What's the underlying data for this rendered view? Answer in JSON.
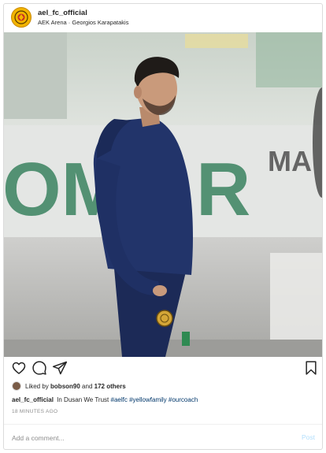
{
  "post": {
    "username": "ael_fc_official",
    "location": "AEK Arena · Georgios Karapatakis",
    "likes": {
      "prefix": "Liked by",
      "user": "bobson90",
      "connector": "and",
      "others": "172 others"
    },
    "caption": {
      "username": "ael_fc_official",
      "text": "In Dusan We Trust",
      "hashtags": [
        "#aelfc",
        "#yellowfamily",
        "#ourcoach"
      ]
    },
    "time": "18 MINUTES AGO"
  },
  "comment": {
    "placeholder": "Add a comment...",
    "post_label": "Post"
  },
  "photo_text": {
    "banner_left": "OM",
    "banner_mid": "R",
    "banner_right": "MA"
  },
  "icons": {
    "like": "heart-icon",
    "comment": "comment-icon",
    "share": "paper-plane-icon",
    "save": "bookmark-icon",
    "avatar": "club-crest-avatar"
  },
  "colors": {
    "hashtag": "#00376b",
    "muted": "#8e8e8e",
    "post_disabled": "#b2dffc",
    "crest": "#f2b400"
  }
}
